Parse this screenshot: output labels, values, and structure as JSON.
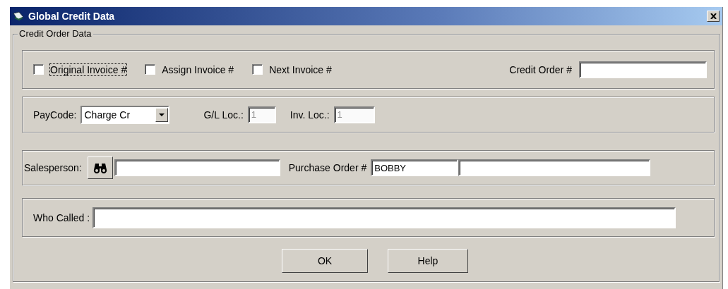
{
  "window": {
    "title": "Global Credit Data"
  },
  "group": {
    "title": "Credit Order Data"
  },
  "invoice_options": [
    {
      "label": "Original Invoice #",
      "checked": false,
      "focused": true
    },
    {
      "label": "Assign Invoice #",
      "checked": false,
      "focused": false
    },
    {
      "label": "Next Invoice #",
      "checked": false,
      "focused": false
    }
  ],
  "credit_order": {
    "label": "Credit Order #"
  },
  "paycode": {
    "label": "PayCode:",
    "value": "Charge Cr"
  },
  "locations": [
    {
      "label": "G/L Loc.:",
      "value": "1",
      "disabled": true
    },
    {
      "label": "Inv. Loc.:",
      "value": "1",
      "disabled": true
    }
  ],
  "salesperson": {
    "label": "Salesperson:"
  },
  "purchase_order": {
    "label": "Purchase Order #",
    "value": "BOBBY"
  },
  "who_called": {
    "label": "Who Called :"
  },
  "buttons": [
    {
      "label": "OK"
    },
    {
      "label": "Help"
    }
  ]
}
